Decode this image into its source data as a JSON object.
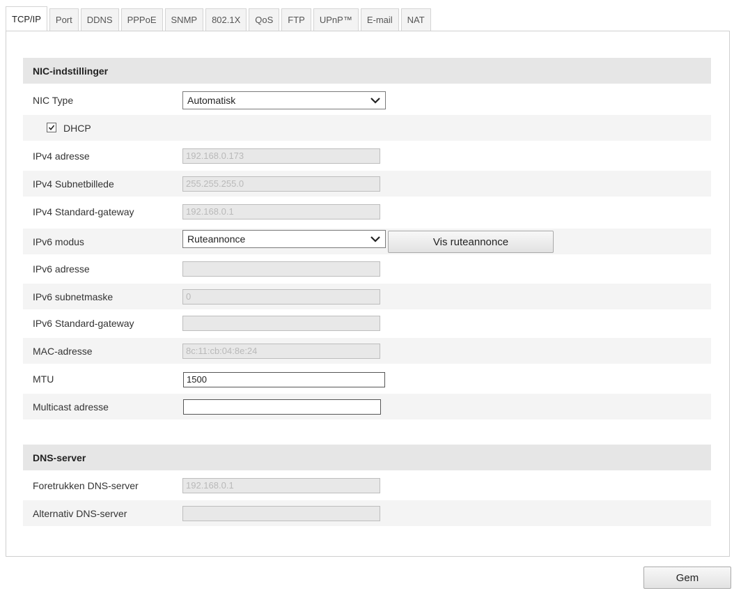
{
  "tabs": [
    {
      "label": "TCP/IP",
      "active": true
    },
    {
      "label": "Port",
      "active": false
    },
    {
      "label": "DDNS",
      "active": false
    },
    {
      "label": "PPPoE",
      "active": false
    },
    {
      "label": "SNMP",
      "active": false
    },
    {
      "label": "802.1X",
      "active": false
    },
    {
      "label": "QoS",
      "active": false
    },
    {
      "label": "FTP",
      "active": false
    },
    {
      "label": "UPnP™",
      "active": false
    },
    {
      "label": "E-mail",
      "active": false
    },
    {
      "label": "NAT",
      "active": false
    }
  ],
  "nic": {
    "title": "NIC-indstillinger",
    "nic_type": {
      "label": "NIC Type",
      "value": "Automatisk"
    },
    "dhcp": {
      "label": "DHCP",
      "checked": true
    },
    "ipv4_address": {
      "label": "IPv4 adresse",
      "value": "192.168.0.173"
    },
    "ipv4_subnet": {
      "label": "IPv4 Subnetbillede",
      "value": "255.255.255.0"
    },
    "ipv4_gateway": {
      "label": "IPv4 Standard-gateway",
      "value": "192.168.0.1"
    },
    "ipv6_mode": {
      "label": "IPv6 modus",
      "value": "Ruteannonce",
      "button": "Vis ruteannonce"
    },
    "ipv6_address": {
      "label": "IPv6 adresse",
      "value": ""
    },
    "ipv6_subnet": {
      "label": "IPv6 subnetmaske",
      "value": "0"
    },
    "ipv6_gateway": {
      "label": "IPv6 Standard-gateway",
      "value": ""
    },
    "mac": {
      "label": "MAC-adresse",
      "value": "8c:11:cb:04:8e:24"
    },
    "mtu": {
      "label": "MTU",
      "value": "1500"
    },
    "multicast": {
      "label": "Multicast adresse",
      "value": ""
    }
  },
  "dns": {
    "title": "DNS-server",
    "preferred": {
      "label": "Foretrukken DNS-server",
      "value": "192.168.0.1"
    },
    "alternate": {
      "label": "Alternativ DNS-server",
      "value": ""
    }
  },
  "save_label": "Gem",
  "icons": {
    "select_arrow": "chevron-down-icon",
    "check": "checkmark-icon"
  }
}
